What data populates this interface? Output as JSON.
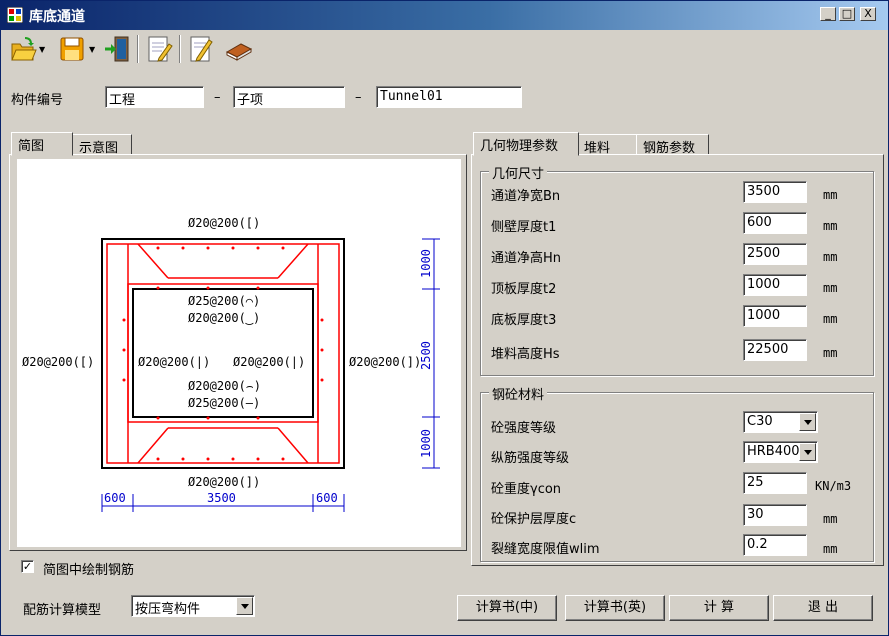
{
  "window": {
    "title": "库底通道",
    "min": "_",
    "max": "□",
    "close": "X"
  },
  "toolbar": {
    "open": "open-icon",
    "save": "save-icon",
    "exit": "exit-icon",
    "edit1": "edit-doc-icon",
    "edit2": "edit-pen-icon",
    "help": "book-icon"
  },
  "id_row": {
    "label": "构件编号",
    "project": "工程",
    "sep": "–",
    "subitem": "子项",
    "name": "Tunnel01"
  },
  "left_tabs": [
    "简图",
    "示意图"
  ],
  "right_tabs": [
    "几何物理参数",
    "堆料",
    "钢筋参数"
  ],
  "geometry": {
    "title": "几何尺寸",
    "rows": [
      {
        "label": "通道净宽Bn",
        "value": "3500",
        "unit": "mm"
      },
      {
        "label": "侧壁厚度t1",
        "value": "600",
        "unit": "mm"
      },
      {
        "label": "通道净高Hn",
        "value": "2500",
        "unit": "mm"
      },
      {
        "label": "顶板厚度t2",
        "value": "1000",
        "unit": "mm"
      },
      {
        "label": "底板厚度t3",
        "value": "1000",
        "unit": "mm"
      },
      {
        "label": "堆料高度Hs",
        "value": "22500",
        "unit": "mm"
      }
    ]
  },
  "material": {
    "title": "钢砼材料",
    "concrete_grade": {
      "label": "砼强度等级",
      "value": "C30"
    },
    "rebar_grade": {
      "label": "纵筋强度等级",
      "value": "HRB400"
    },
    "density": {
      "label": "砼重度γcon",
      "value": "25",
      "unit": "KN/m3"
    },
    "cover": {
      "label": "砼保护层厚度c",
      "value": "30",
      "unit": "mm"
    },
    "crack": {
      "label": "裂缝宽度限值wlim",
      "value": "0.2",
      "unit": "mm"
    }
  },
  "drawing": {
    "top_outer": "Ø20@200([)",
    "top_inner1": "Ø25@200(⌒)",
    "top_inner2": "Ø20@200(‿)",
    "left_outer": "Ø20@200([)",
    "left_inner": "Ø20@200(|)",
    "right_inner": "Ø20@200(|)",
    "right_outer": "Ø20@200(])",
    "bot_inner1": "Ø20@200(⌢)",
    "bot_inner2": "Ø25@200(—)",
    "bot_outer": "Ø20@200(])",
    "dim_left": "600",
    "dim_mid": "3500",
    "dim_right": "600",
    "vdim_top": "1000",
    "vdim_mid": "2500",
    "vdim_bot": "1000"
  },
  "draw_rebar": {
    "label": "简图中绘制钢筋",
    "checked": true,
    "mark": "✓"
  },
  "model": {
    "label": "配筋计算模型",
    "value": "按压弯构件"
  },
  "buttons": {
    "calc_cn": "计算书(中)",
    "calc_en": "计算书(英)",
    "calc": "计  算",
    "exit": "退  出"
  },
  "colors": {
    "title_start": "#0a246a",
    "title_end": "#a6caf0",
    "rebar": "#ff0000",
    "dim": "#0000cc"
  }
}
